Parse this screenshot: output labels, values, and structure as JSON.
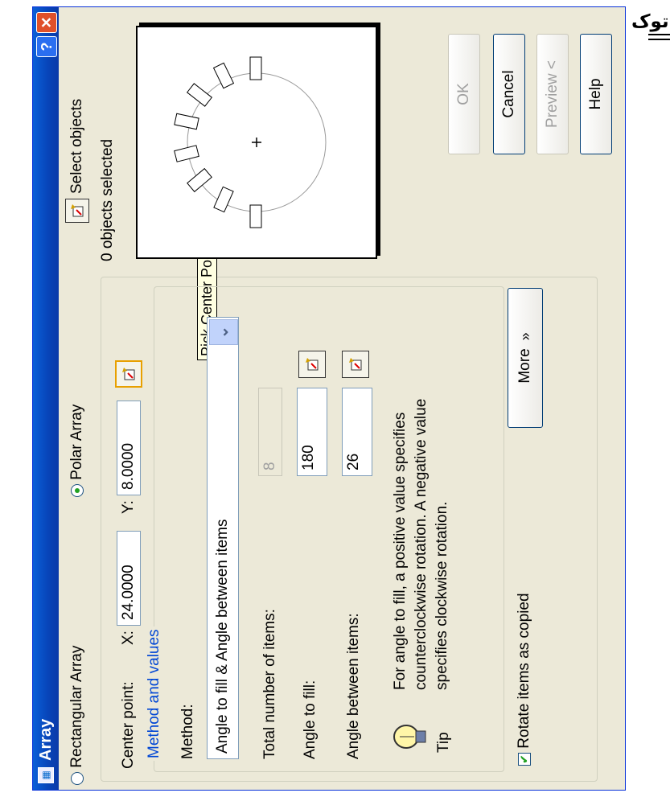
{
  "side_text": "اتوک",
  "window": {
    "title": "Array",
    "help_label": "?",
    "close_label": "✕"
  },
  "array_type": {
    "rectangular_label": "Rectangular Array",
    "polar_label": "Polar Array",
    "selected": "Polar Array"
  },
  "select_objects": {
    "label": "Select objects",
    "status": "0 objects selected"
  },
  "center_point": {
    "label": "Center point:",
    "x_label": "X:",
    "x_value": "24.0000",
    "y_label": "Y:",
    "y_value": "8.0000",
    "tooltip": "Pick Center Point"
  },
  "method_group": {
    "title": "Method and values",
    "method_label": "Method:",
    "method_value": "Angle to fill & Angle between items",
    "total_items_label": "Total number of items:",
    "total_items_value": "8",
    "angle_fill_label": "Angle to fill:",
    "angle_fill_value": "180",
    "angle_between_label": "Angle between items:",
    "angle_between_value": "26",
    "tip_line1": "For angle to fill, a positive value specifies",
    "tip_line2": "counterclockwise rotation.  A negative value",
    "tip_line3": "specifies clockwise rotation.",
    "tip_label": "Tip"
  },
  "options": {
    "rotate_label": "Rotate items as copied",
    "rotate_checked": true,
    "more_label": "More"
  },
  "buttons": {
    "ok": "OK",
    "cancel": "Cancel",
    "preview": "Preview <",
    "help": "Help"
  },
  "icons": {
    "pick": "pick-point-icon",
    "tip": "lightbulb-icon",
    "app": "array-app-icon"
  }
}
